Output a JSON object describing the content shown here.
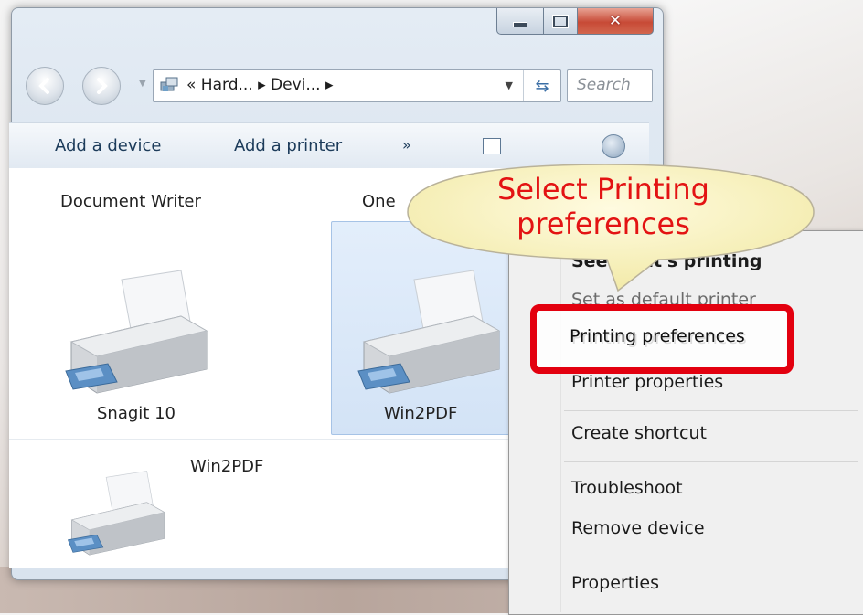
{
  "window": {
    "minimize_icon": "minimize-icon",
    "maximize_icon": "maximize-icon",
    "close_icon": "close-icon"
  },
  "nav": {
    "back_icon": "back-arrow-icon",
    "forward_icon": "forward-arrow-icon",
    "address_text": "« Hard... ▸ Devi... ▸",
    "search_placeholder": "Search"
  },
  "toolbar": {
    "add_device": "Add a device",
    "add_printer": "Add a printer",
    "more": "»"
  },
  "content": {
    "labels": {
      "document_writer": "Document Writer",
      "onenote_partial": "One",
      "snagit": "Snagit 10",
      "win2pdf_selected": "Win2PDF",
      "win2pdf_second": "Win2PDF"
    }
  },
  "callout": {
    "line1": "Select Printing",
    "line2": "preferences"
  },
  "menu": {
    "items": [
      {
        "label": "See what's printing",
        "bold": true
      },
      {
        "label": "Set as default printer"
      },
      {
        "label": "Printing preferences"
      },
      {
        "label": "Printer properties"
      },
      {
        "label": "Create shortcut"
      },
      {
        "label": "Troubleshoot"
      },
      {
        "label": "Remove device"
      },
      {
        "label": "Properties"
      }
    ]
  },
  "colors": {
    "callout_text": "#e31313",
    "highlight_border": "#e3000f"
  }
}
